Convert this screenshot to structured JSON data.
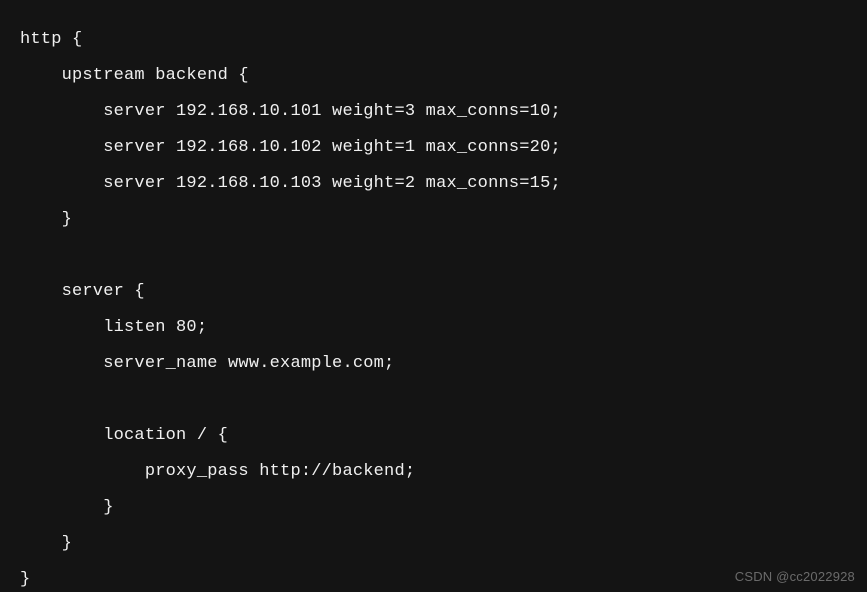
{
  "lines": [
    "http {",
    "    upstream backend {",
    "        server 192.168.10.101 weight=3 max_conns=10;",
    "        server 192.168.10.102 weight=1 max_conns=20;",
    "        server 192.168.10.103 weight=2 max_conns=15;",
    "    }",
    "",
    "    server {",
    "        listen 80;",
    "        server_name www.example.com;",
    "",
    "        location / {",
    "            proxy_pass http://backend;",
    "        }",
    "    }",
    "}"
  ],
  "watermark": "CSDN @cc2022928"
}
